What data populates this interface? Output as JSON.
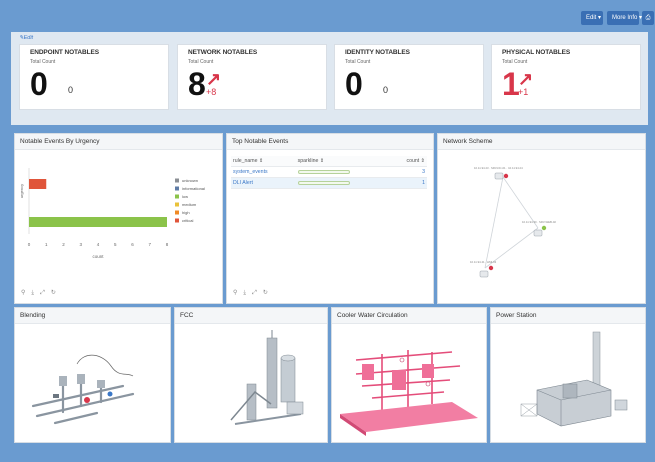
{
  "header": {
    "edit_label": "Edit ▾",
    "more_info_label": "More Info ▾",
    "print_icon": "print-icon"
  },
  "notables": {
    "edit_link": "✎Edit",
    "cards": [
      {
        "title": "ENDPOINT NOTABLES",
        "sub": "Total Count",
        "value": "0",
        "small": "0",
        "trend": ""
      },
      {
        "title": "NETWORK NOTABLES",
        "sub": "Total Count",
        "value": "8",
        "small": "",
        "trend": "+8"
      },
      {
        "title": "IDENTITY NOTABLES",
        "sub": "Total Count",
        "value": "0",
        "small": "0",
        "trend": ""
      },
      {
        "title": "PHYSICAL NOTABLES",
        "sub": "Total Count",
        "value": "1",
        "small": "",
        "trend": "+1"
      }
    ]
  },
  "panels": {
    "urgency": {
      "title": "Notable Events By Urgency"
    },
    "top_notable": {
      "title": "Top Notable Events",
      "columns": [
        "rule_name ⇕",
        "sparkline ⇕",
        "count ⇕"
      ],
      "rows": [
        {
          "rule_name": "system_events",
          "count": "3"
        },
        {
          "rule_name": "DLI Alert",
          "count": "1"
        }
      ]
    },
    "network": {
      "title": "Network Scheme"
    },
    "blending": {
      "title": "Blending"
    },
    "fcc": {
      "title": "FCC"
    },
    "cooler": {
      "title": "Cooler Water Circulation"
    },
    "power": {
      "title": "Power Station"
    }
  },
  "chart_data": {
    "type": "bar",
    "orientation": "horizontal",
    "title": "Notable Events By Urgency",
    "xlabel": "count",
    "ylabel": "urgency",
    "xlim": [
      0,
      8
    ],
    "xticks": [
      "0",
      "1",
      "2",
      "3",
      "4",
      "5",
      "6",
      "7",
      "8"
    ],
    "categories": [
      "critical",
      "medium"
    ],
    "values": [
      1,
      8
    ],
    "colors": [
      "#e0553a",
      "#8bc34a"
    ],
    "legend": {
      "placement": "right",
      "items": [
        {
          "name": "unknown",
          "color": "#8b8f94"
        },
        {
          "name": "informational",
          "color": "#5f7ca6"
        },
        {
          "name": "low",
          "color": "#8bc34a"
        },
        {
          "name": "medium",
          "color": "#e9c23a"
        },
        {
          "name": "high",
          "color": "#f08a24"
        },
        {
          "name": "critical",
          "color": "#e0553a"
        }
      ]
    }
  },
  "tool_icons": [
    "⚲",
    "⤓",
    "⤢",
    "↻"
  ]
}
